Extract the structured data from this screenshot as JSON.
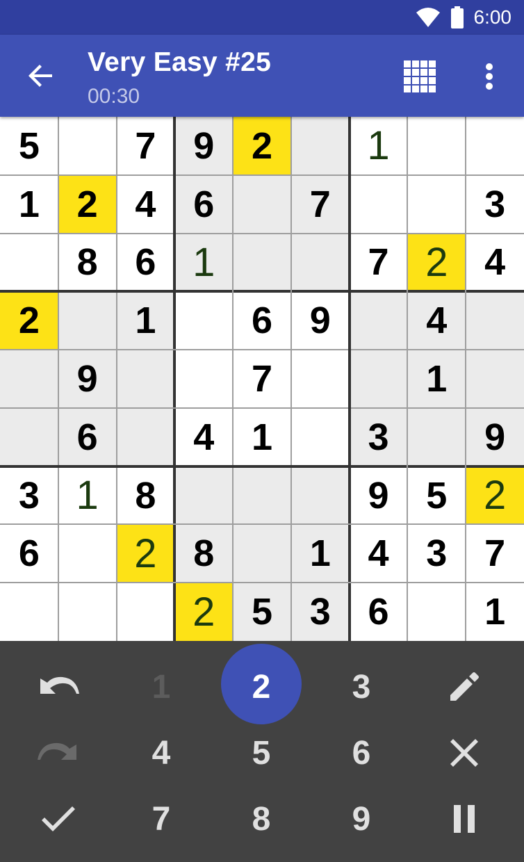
{
  "status_bar": {
    "time": "6:00"
  },
  "app_bar": {
    "title": "Very Easy #25",
    "timer": "00:30"
  },
  "board": {
    "rows": [
      [
        "5",
        "",
        "7",
        "9",
        "2",
        "",
        "1",
        "",
        ""
      ],
      [
        "1",
        "2",
        "4",
        "6",
        "",
        "7",
        "",
        "",
        "3"
      ],
      [
        "",
        "8",
        "6",
        "1",
        "",
        "",
        "7",
        "2",
        "4"
      ],
      [
        "2",
        "",
        "1",
        "",
        "6",
        "9",
        "",
        "4",
        ""
      ],
      [
        "",
        "9",
        "",
        "",
        "7",
        "",
        "",
        "1",
        ""
      ],
      [
        "",
        "6",
        "",
        "4",
        "1",
        "",
        "3",
        "",
        "9"
      ],
      [
        "3",
        "1",
        "8",
        "",
        "",
        "",
        "9",
        "5",
        "2"
      ],
      [
        "6",
        "",
        "2",
        "8",
        "",
        "1",
        "4",
        "3",
        "7"
      ],
      [
        "",
        "",
        "",
        "2",
        "5",
        "3",
        "6",
        "",
        "1"
      ]
    ],
    "user_entered": [
      [
        0,
        6
      ],
      [
        2,
        3
      ],
      [
        2,
        7
      ],
      [
        6,
        1
      ],
      [
        6,
        8
      ],
      [
        7,
        2
      ],
      [
        8,
        3
      ]
    ],
    "highlighted": [
      [
        0,
        4
      ],
      [
        1,
        1
      ],
      [
        2,
        7
      ],
      [
        3,
        0
      ],
      [
        6,
        8
      ],
      [
        7,
        2
      ],
      [
        8,
        3
      ]
    ],
    "highlight_color": "#fde216",
    "shade_color": "#ebebeb"
  },
  "keypad": {
    "numbers": [
      "1",
      "2",
      "3",
      "4",
      "5",
      "6",
      "7",
      "8",
      "9"
    ],
    "selected": "2",
    "disabled": [
      "1"
    ],
    "actions": {
      "undo": "undo-icon",
      "redo": "redo-icon",
      "pencil": "pencil-icon",
      "clear": "close-icon",
      "check": "check-icon",
      "pause": "pause-icon"
    },
    "accent": "#3f51b5"
  }
}
